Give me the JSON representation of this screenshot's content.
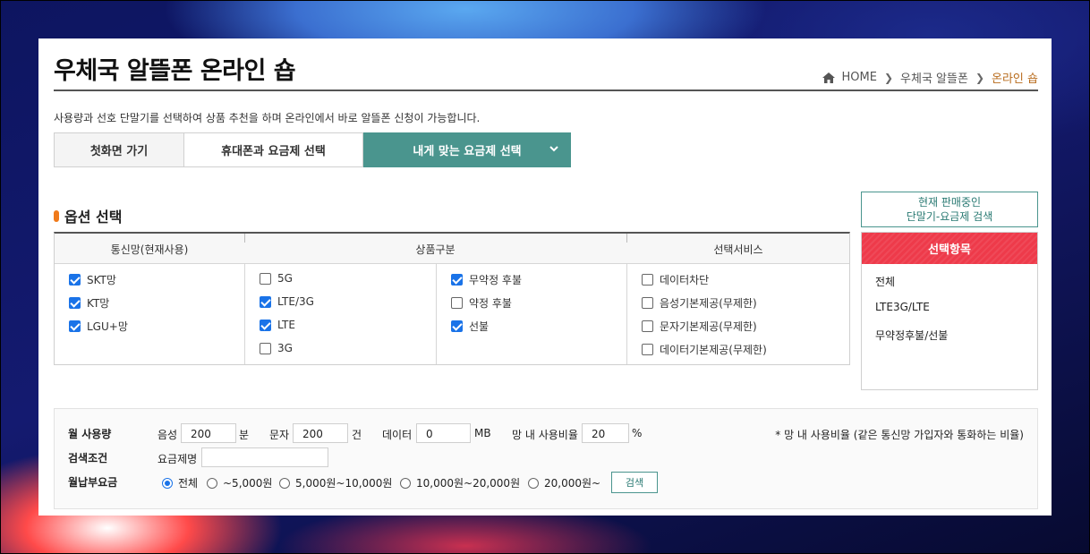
{
  "header": {
    "title": "우체국 알뜰폰 온라인 숍",
    "breadcrumb": {
      "home": "HOME",
      "level2": "우체국 알뜰폰",
      "current": "온라인 숍"
    }
  },
  "intro": "사용량과 선호 단말기를 선택하여 상품 추천을 하며 온라인에서 바로 알뜰폰 신청이 가능합니다.",
  "tabs": [
    {
      "label": "첫화면 가기"
    },
    {
      "label": "휴대폰과 요금제 선택"
    },
    {
      "label": "내게 맞는 요금제 선택",
      "active": true
    }
  ],
  "options": {
    "section_title": "옵션 선택",
    "headers": {
      "network": "통신망(현재사용)",
      "product": "상품구분",
      "service": "선택서비스"
    },
    "network": [
      {
        "label": "SKT망",
        "checked": true
      },
      {
        "label": "KT망",
        "checked": true
      },
      {
        "label": "LGU+망",
        "checked": true
      }
    ],
    "product_type": [
      {
        "label": "5G",
        "checked": false
      },
      {
        "label": "LTE/3G",
        "checked": true
      },
      {
        "label": "LTE",
        "checked": true
      },
      {
        "label": "3G",
        "checked": false
      }
    ],
    "contract": [
      {
        "label": "무약정 후불",
        "checked": true
      },
      {
        "label": "약정 후불",
        "checked": false
      },
      {
        "label": "선불",
        "checked": true
      }
    ],
    "service": [
      {
        "label": "데이터차단",
        "checked": false
      },
      {
        "label": "음성기본제공(무제한)",
        "checked": false
      },
      {
        "label": "문자기본제공(무제한)",
        "checked": false
      },
      {
        "label": "데이터기본제공(무제한)",
        "checked": false
      }
    ]
  },
  "sidebar": {
    "search_button": {
      "line1": "현재 판매중인",
      "line2": "단말기-요금제 검색"
    },
    "selected_title": "선택항목",
    "items": [
      "전체",
      "LTE3G/LTE",
      "무약정후불/선불"
    ]
  },
  "search": {
    "usage_label": "월 사용량",
    "voice_label": "음성",
    "voice_value": "200",
    "voice_unit": "분",
    "sms_label": "문자",
    "sms_value": "200",
    "sms_unit": "건",
    "data_label": "데이터",
    "data_value": "0",
    "data_unit": "MB",
    "ratio_label": "망 내 사용비율",
    "ratio_value": "20",
    "ratio_unit": "%",
    "note": "* 망 내 사용비율 (같은 통신망 가입자와 통화하는 비율)",
    "condition_label": "검색조건",
    "plan_name_label": "요금제명",
    "plan_name_value": "",
    "fee_label": "월납부요금",
    "fee_options": [
      {
        "label": "전체",
        "selected": true
      },
      {
        "label": "~5,000원",
        "selected": false
      },
      {
        "label": "5,000원~10,000원",
        "selected": false
      },
      {
        "label": "10,000원~20,000원",
        "selected": false
      },
      {
        "label": "20,000원~",
        "selected": false
      }
    ],
    "search_button": "검색"
  },
  "colors": {
    "accent": "#4a958e",
    "selected_header": "#ee3a4a",
    "breadcrumb_current": "#b86b1c",
    "checkbox": "#1a73e8"
  }
}
